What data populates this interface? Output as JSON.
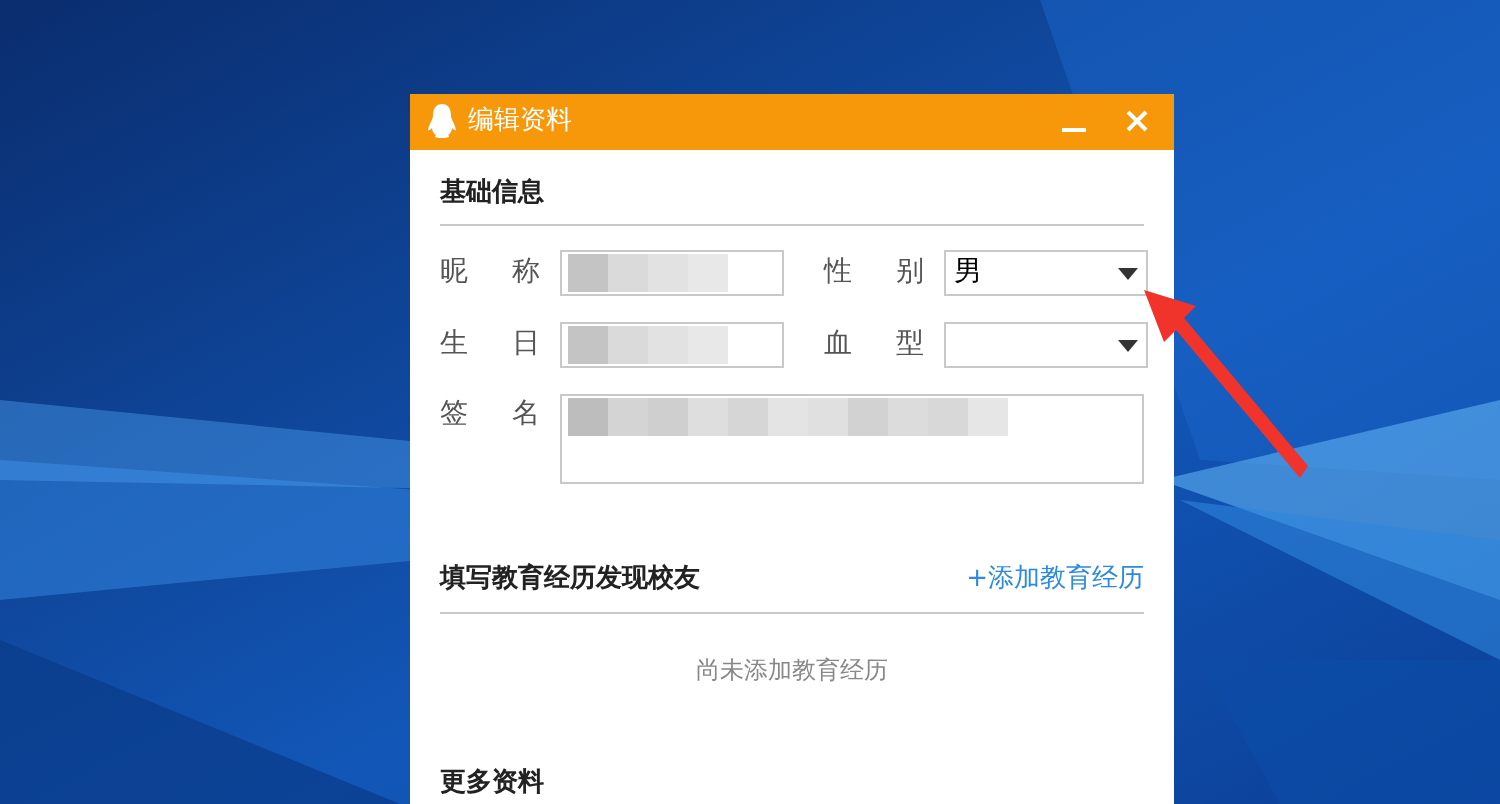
{
  "window": {
    "title": "编辑资料"
  },
  "basic": {
    "heading": "基础信息",
    "fields": [
      {
        "label": "昵称",
        "kind": "text",
        "redacted": true
      },
      {
        "label": "性别",
        "kind": "select",
        "value": "男"
      },
      {
        "label": "生日",
        "kind": "text",
        "redacted": true
      },
      {
        "label": "血型",
        "kind": "select"
      },
      {
        "label": "签名",
        "kind": "textarea",
        "redacted": true
      }
    ]
  },
  "education": {
    "heading": "填写教育经历发现校友",
    "link": "+添加教育经历",
    "empty": "尚未添加教育经历"
  },
  "more": {
    "heading": "更多资料"
  }
}
